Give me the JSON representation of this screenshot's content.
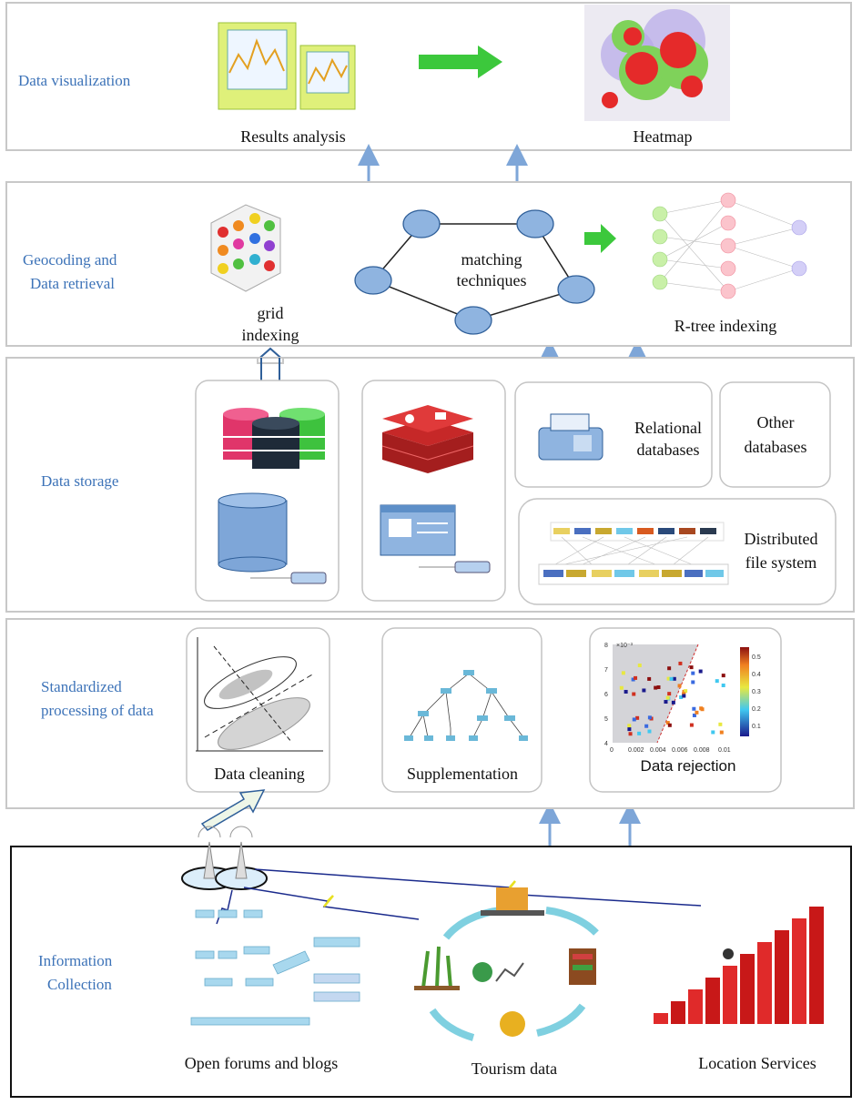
{
  "layers": {
    "visualization": {
      "label": "Data visualization",
      "results_caption": "Results analysis",
      "heatmap_caption": "Heatmap"
    },
    "geocoding": {
      "label_line1": "Geocoding and",
      "label_line2": "Data retrieval",
      "grid_line1": "grid",
      "grid_line2": "indexing",
      "matching_line1": "matching",
      "matching_line2": "techniques",
      "rtree_caption": "R-tree indexing"
    },
    "storage": {
      "label": "Data storage",
      "relational_line1": "Relational",
      "relational_line2": "databases",
      "other_line1": "Other",
      "other_line2": "databases",
      "dfs_line1": "Distributed",
      "dfs_line2": "file system"
    },
    "processing": {
      "label_line1": "Standardized",
      "label_line2": "processing of data",
      "cleaning_caption": "Data cleaning",
      "supplementation_caption": "Supplementation",
      "rejection_caption": "Data rejection",
      "rejection_plot": {
        "x_ticks": [
          "0",
          "0.002",
          "0.004",
          "0.006",
          "0.008",
          "0.01"
        ],
        "y_ticks": [
          "4",
          "5",
          "6",
          "7",
          "8"
        ],
        "y_scale": "×10⁻³",
        "colorbar_ticks": [
          "0.1",
          "0.2",
          "0.3",
          "0.4",
          "0.5"
        ]
      }
    },
    "collection": {
      "label_line1": "Information",
      "label_line2": "Collection",
      "forums_caption": "Open forums and blogs",
      "tourism_caption": "Tourism data",
      "location_caption": "Location Services"
    }
  },
  "colors": {
    "label": "#3d73b8",
    "arrow": "#7ea6d8",
    "green_arrow": "#3cc83c",
    "node": "#8fb4e0"
  }
}
